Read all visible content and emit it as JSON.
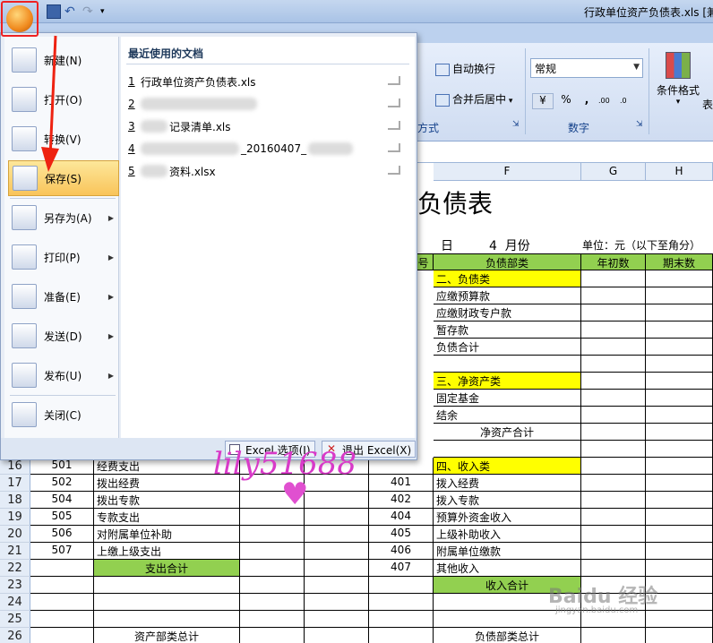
{
  "window": {
    "title": "行政单位资产负债表.xls [兼"
  },
  "ribbon": {
    "wrap_text": "自动换行",
    "merge_center": "合并后居中",
    "number_format": "常规",
    "percent": "%",
    "comma": ",",
    "group_alignment_partial": "方式",
    "group_number": "数字",
    "conditional_format": "条件格式",
    "table_partial": "表"
  },
  "menu": {
    "items": [
      {
        "label": "新建(N)",
        "icon": "new-document-icon",
        "arrow": false
      },
      {
        "label": "打开(O)",
        "icon": "open-folder-icon",
        "arrow": false
      },
      {
        "label": "转换(V)",
        "icon": "convert-icon",
        "arrow": false
      },
      {
        "label": "保存(S)",
        "icon": "save-icon",
        "arrow": false
      },
      {
        "label": "另存为(A)",
        "icon": "save-as-icon",
        "arrow": true
      },
      {
        "label": "打印(P)",
        "icon": "printer-icon",
        "arrow": true
      },
      {
        "label": "准备(E)",
        "icon": "prepare-icon",
        "arrow": true
      },
      {
        "label": "发送(D)",
        "icon": "send-icon",
        "arrow": true
      },
      {
        "label": "发布(U)",
        "icon": "publish-icon",
        "arrow": true
      },
      {
        "label": "关闭(C)",
        "icon": "close-folder-icon",
        "arrow": false
      }
    ],
    "recent_title": "最近使用的文档",
    "recent": [
      {
        "num": "1",
        "name": "行政单位资产负债表.xls"
      },
      {
        "num": "2",
        "name": ""
      },
      {
        "num": "3",
        "name": "记录清单.xls"
      },
      {
        "num": "4",
        "name": "_20160407_"
      },
      {
        "num": "5",
        "name": "资料.xlsx"
      }
    ],
    "options_button": "Excel 选项(I)",
    "exit_button": "退出 Excel(X)"
  },
  "sheet": {
    "col_headers": [
      "F",
      "G",
      "H"
    ],
    "title_partial": "负债表",
    "subtitle_day": "日",
    "subtitle_month": "4  月份",
    "unit": "单位：元（以下至角分）",
    "header_row": {
      "code": "号",
      "f": "负债部类",
      "g": "年初数",
      "h": "期末数"
    },
    "upper_rows": [
      {
        "f": "二、负债类",
        "yellow": true
      },
      {
        "f": "应缴预算款"
      },
      {
        "f": "应缴财政专户款"
      },
      {
        "f": "暂存款"
      },
      {
        "f": "负债合计"
      },
      {
        "f": ""
      },
      {
        "f": "三、净资产类",
        "yellow": true
      },
      {
        "f": "固定基金"
      },
      {
        "f": "结余"
      },
      {
        "f": "净资产合计",
        "center": true
      },
      {
        "f": ""
      }
    ],
    "lower_rows": [
      {
        "n": "16",
        "b": "501",
        "c": "经费支出",
        "e": "",
        "f": "四、收入类",
        "fy": true
      },
      {
        "n": "17",
        "b": "502",
        "c": "拨出经费",
        "e": "401",
        "f": "拨入经费"
      },
      {
        "n": "18",
        "b": "504",
        "c": "拨出专款",
        "e": "402",
        "f": "拨入专款"
      },
      {
        "n": "19",
        "b": "505",
        "c": "专款支出",
        "e": "404",
        "f": "预算外资金收入"
      },
      {
        "n": "20",
        "b": "506",
        "c": "对附属单位补助",
        "e": "405",
        "f": "上级补助收入"
      },
      {
        "n": "21",
        "b": "507",
        "c": "上缴上级支出",
        "e": "406",
        "f": "附属单位缴款"
      },
      {
        "n": "22",
        "b": "",
        "c": "支出合计",
        "cg": true,
        "e": "407",
        "f": "其他收入"
      },
      {
        "n": "23",
        "b": "",
        "c": "",
        "e": "",
        "f": "收入合计",
        "fg": true
      },
      {
        "n": "24",
        "b": "",
        "c": "",
        "e": "",
        "f": ""
      },
      {
        "n": "25",
        "b": "",
        "c": "",
        "e": "",
        "f": ""
      },
      {
        "n": "26",
        "b": "",
        "c": "资产部类总计",
        "e": "",
        "f": "负债部类总计"
      }
    ]
  },
  "watermark": {
    "text": "lily51688",
    "brand": "Baidu 经验",
    "url": "jingyan.baidu.com"
  },
  "colors": {
    "yellow": "#ffff00",
    "green": "#92d050",
    "highlight": "#f9c45a"
  }
}
